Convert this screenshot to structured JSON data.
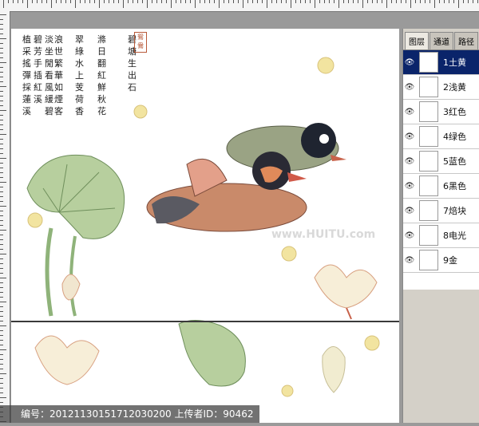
{
  "poem_columns": [
    "碧塘生出石",
    "滌日翻紅鮮秋花",
    "翠綠水上芰荷香",
    "浪世繁華如煙客",
    "淡坐閒看風緩碧",
    "碧芳手插紅溪",
    "植采搖彈採蓮溪"
  ],
  "seal_text": "鴛鴦",
  "watermark_text": "编号：20121130151712030200 上传者ID：90462",
  "site_watermark": "www.HUITU.com",
  "layers_panel": {
    "tabs": [
      "图层",
      "通道",
      "路径"
    ],
    "active_tab_index": 0,
    "layers": [
      {
        "name": "1土黄",
        "selected": true
      },
      {
        "name": "2浅黄",
        "selected": false
      },
      {
        "name": "3红色",
        "selected": false
      },
      {
        "name": "4绿色",
        "selected": false
      },
      {
        "name": "5蓝色",
        "selected": false
      },
      {
        "name": "6黑色",
        "selected": false
      },
      {
        "name": "7焙块",
        "selected": false
      },
      {
        "name": "8电光",
        "selected": false
      },
      {
        "name": "9金",
        "selected": false
      }
    ]
  },
  "colors": {
    "selection": "#0a246a",
    "leaf": "#8fb37a",
    "duck_red": "#c8624a",
    "gold_dot": "#f2e4a0"
  }
}
